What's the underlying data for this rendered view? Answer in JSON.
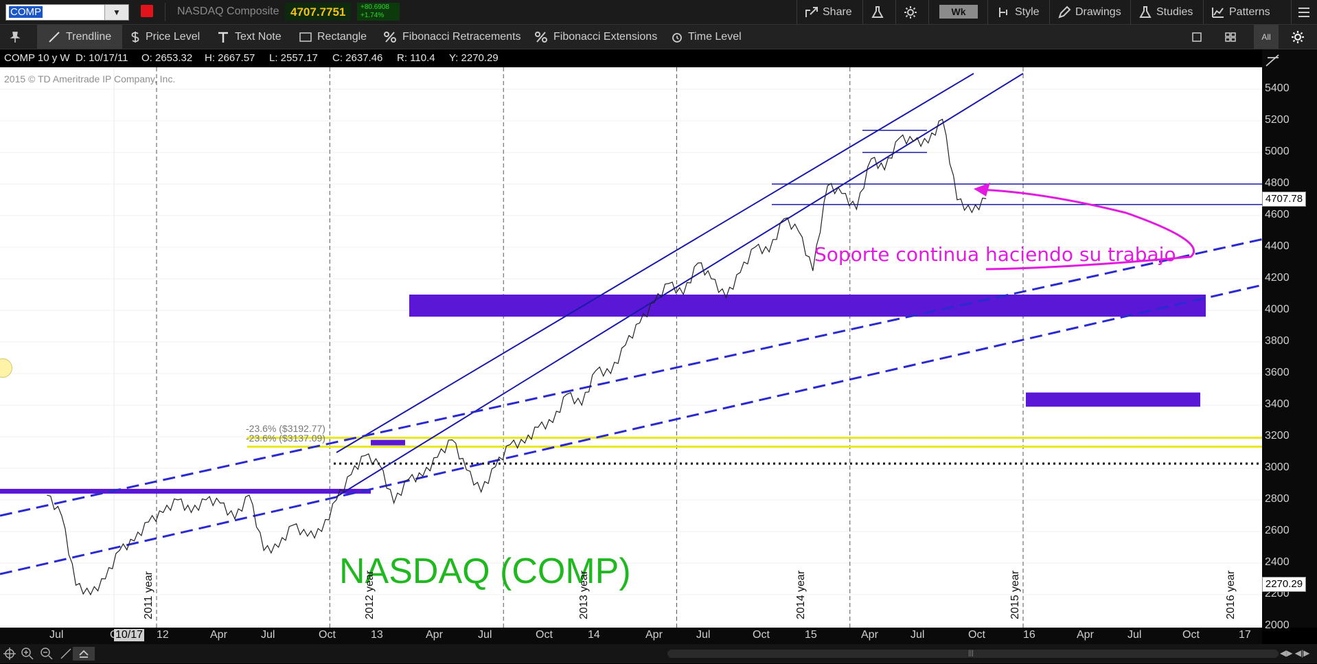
{
  "symbol": {
    "value": "COMP"
  },
  "instrument": {
    "name": "NASDAQ Composite",
    "last_price": "4707.7751",
    "change_abs": "+80.6908",
    "change_pct": "+1.74%"
  },
  "header_buttons": {
    "share": "Share",
    "timeframe": "Wk",
    "style": "Style",
    "drawings": "Drawings",
    "studies": "Studies",
    "patterns": "Patterns"
  },
  "drawing_tools": [
    "Trendline",
    "Price Level",
    "Text Note",
    "Rectangle",
    "Fibonacci Retracements",
    "Fibonacci Extensions",
    "Time Level"
  ],
  "drawing_right": {
    "all_label": "All"
  },
  "info": {
    "symbol_period": "COMP 10 y W",
    "date": "D: 10/17/11",
    "open": "O: 2653.32",
    "high": "H: 2667.57",
    "low": "L: 2557.17",
    "close": "C: 2637.46",
    "range": "R: 110.4",
    "y": "Y: 2270.29"
  },
  "copyright": "2015 © TD Ameritrade IP Company, Inc.",
  "annotations": {
    "soporte": "Soporte continua haciendo su trabajo",
    "title": "NASDAQ (COMP)",
    "fib_upper": "-23.6%  ($3192.77)",
    "fib_lower": "-23.6%  ($3137.09)"
  },
  "price_axis": [
    "5400",
    "5200",
    "5000",
    "4800",
    "4600",
    "4400",
    "4200",
    "4000",
    "3800",
    "3600",
    "3400",
    "3200",
    "3000",
    "2800",
    "2600",
    "2400",
    "2200",
    "2000"
  ],
  "price_badges": {
    "last": "4707.78",
    "cursor": "2270.29"
  },
  "time_axis": [
    "Jul",
    "Oc",
    "10/17",
    "12",
    "Apr",
    "Jul",
    "Oct",
    "13",
    "Apr",
    "Jul",
    "Oct",
    "14",
    "Apr",
    "Jul",
    "Oct",
    "15",
    "Apr",
    "Jul",
    "Oct",
    "16",
    "Apr",
    "Jul",
    "Oct",
    "17"
  ],
  "year_labels": [
    "2011 year",
    "2012 year",
    "2013 year",
    "2014 year",
    "2015 year",
    "2016 year"
  ],
  "colors": {
    "accent_blue": "#1a1aa8",
    "purple_zone": "#5a17d6",
    "fib_yellow": "#e8e81a",
    "soporte_magenta": "#e21be0",
    "title_green": "#1fb81f"
  },
  "chart_data": {
    "type": "line",
    "ylim": [
      2000,
      5500
    ],
    "x_range": [
      "2010-05",
      "2017-02"
    ],
    "series": [
      {
        "values_weekly_approx": [
          [
            "2010-05",
            2830
          ],
          [
            "2010-06",
            2700
          ],
          [
            "2010-07",
            2260
          ],
          [
            "2010-08",
            2200
          ],
          [
            "2010-09",
            2300
          ],
          [
            "2010-10",
            2480
          ],
          [
            "2010-11",
            2540
          ],
          [
            "2010-12",
            2660
          ],
          [
            "2011-01",
            2720
          ],
          [
            "2011-02",
            2800
          ],
          [
            "2011-03",
            2720
          ],
          [
            "2011-04",
            2800
          ],
          [
            "2011-05",
            2780
          ],
          [
            "2011-06",
            2680
          ],
          [
            "2011-07",
            2830
          ],
          [
            "2011-08",
            2480
          ],
          [
            "2011-09",
            2500
          ],
          [
            "2011-10",
            2640
          ],
          [
            "2011-11",
            2570
          ],
          [
            "2011-12",
            2600
          ],
          [
            "2012-01",
            2800
          ],
          [
            "2012-02",
            2960
          ],
          [
            "2012-03",
            3080
          ],
          [
            "2012-04",
            3020
          ],
          [
            "2012-05",
            2780
          ],
          [
            "2012-06",
            2930
          ],
          [
            "2012-07",
            2950
          ],
          [
            "2012-08",
            3070
          ],
          [
            "2012-09",
            3180
          ],
          [
            "2012-10",
            2990
          ],
          [
            "2012-11",
            2850
          ],
          [
            "2012-12",
            3010
          ],
          [
            "2013-01",
            3150
          ],
          [
            "2013-02",
            3160
          ],
          [
            "2013-03",
            3260
          ],
          [
            "2013-04",
            3290
          ],
          [
            "2013-05",
            3470
          ],
          [
            "2013-06",
            3400
          ],
          [
            "2013-07",
            3620
          ],
          [
            "2013-08",
            3600
          ],
          [
            "2013-09",
            3780
          ],
          [
            "2013-10",
            3920
          ],
          [
            "2013-11",
            4050
          ],
          [
            "2013-12",
            4170
          ],
          [
            "2014-01",
            4100
          ],
          [
            "2014-02",
            4300
          ],
          [
            "2014-03",
            4200
          ],
          [
            "2014-04",
            4080
          ],
          [
            "2014-05",
            4240
          ],
          [
            "2014-06",
            4400
          ],
          [
            "2014-07",
            4370
          ],
          [
            "2014-08",
            4580
          ],
          [
            "2014-09",
            4500
          ],
          [
            "2014-10",
            4250
          ],
          [
            "2014-11",
            4790
          ],
          [
            "2014-12",
            4740
          ],
          [
            "2015-01",
            4640
          ],
          [
            "2015-02",
            4960
          ],
          [
            "2015-03",
            4890
          ],
          [
            "2015-04",
            5090
          ],
          [
            "2015-05",
            5070
          ],
          [
            "2015-06",
            5060
          ],
          [
            "2015-07",
            5210
          ],
          [
            "2015-08",
            4700
          ],
          [
            "2015-09",
            4620
          ],
          [
            "2015-10",
            4707
          ]
        ]
      }
    ]
  }
}
